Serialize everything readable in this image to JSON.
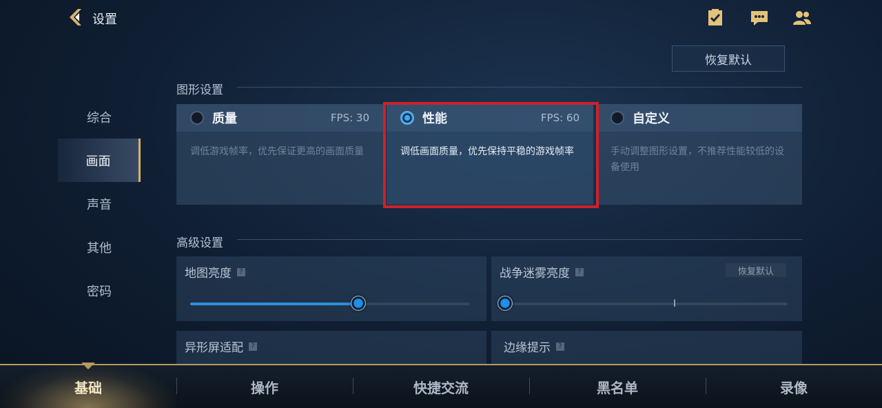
{
  "header": {
    "title": "设置",
    "restore_default": "恢复默认"
  },
  "sidebar": {
    "items": [
      {
        "label": "综合"
      },
      {
        "label": "画面"
      },
      {
        "label": "声音"
      },
      {
        "label": "其他"
      },
      {
        "label": "密码"
      }
    ],
    "selected": "画面"
  },
  "graphics": {
    "section_title": "图形设置",
    "modes": [
      {
        "name": "质量",
        "fps": "FPS: 30",
        "desc": "调低游戏帧率，优先保证更高的画面质量",
        "selected": false
      },
      {
        "name": "性能",
        "fps": "FPS: 60",
        "desc": "调低画面质量，优先保持平稳的游戏帧率",
        "selected": true
      },
      {
        "name": "自定义",
        "fps": "",
        "desc": "手动调整图形设置，不推荐性能较低的设备使用",
        "selected": false
      }
    ]
  },
  "advanced": {
    "section_title": "高级设置",
    "help_mark": "?",
    "map_brightness": {
      "label": "地图亮度",
      "level": 0.6
    },
    "fog_brightness": {
      "label": "战争迷雾亮度",
      "level": 0.0,
      "restore": "恢复默认"
    },
    "notch_adapt": {
      "label": "异形屏适配"
    },
    "edge_hint": {
      "label": "边缘提示"
    }
  },
  "bottom_tabs": [
    {
      "label": "基础",
      "active": true
    },
    {
      "label": "操作"
    },
    {
      "label": "快捷交流"
    },
    {
      "label": "黑名单"
    },
    {
      "label": "录像"
    }
  ],
  "icons": [
    "back-arrow-icon",
    "task-checklist-icon",
    "chat-icon",
    "friends-icon"
  ],
  "colors": {
    "accent_gold": "#d8b26a",
    "accent_blue": "#2d8fe0",
    "highlight_red": "#d0202a"
  }
}
